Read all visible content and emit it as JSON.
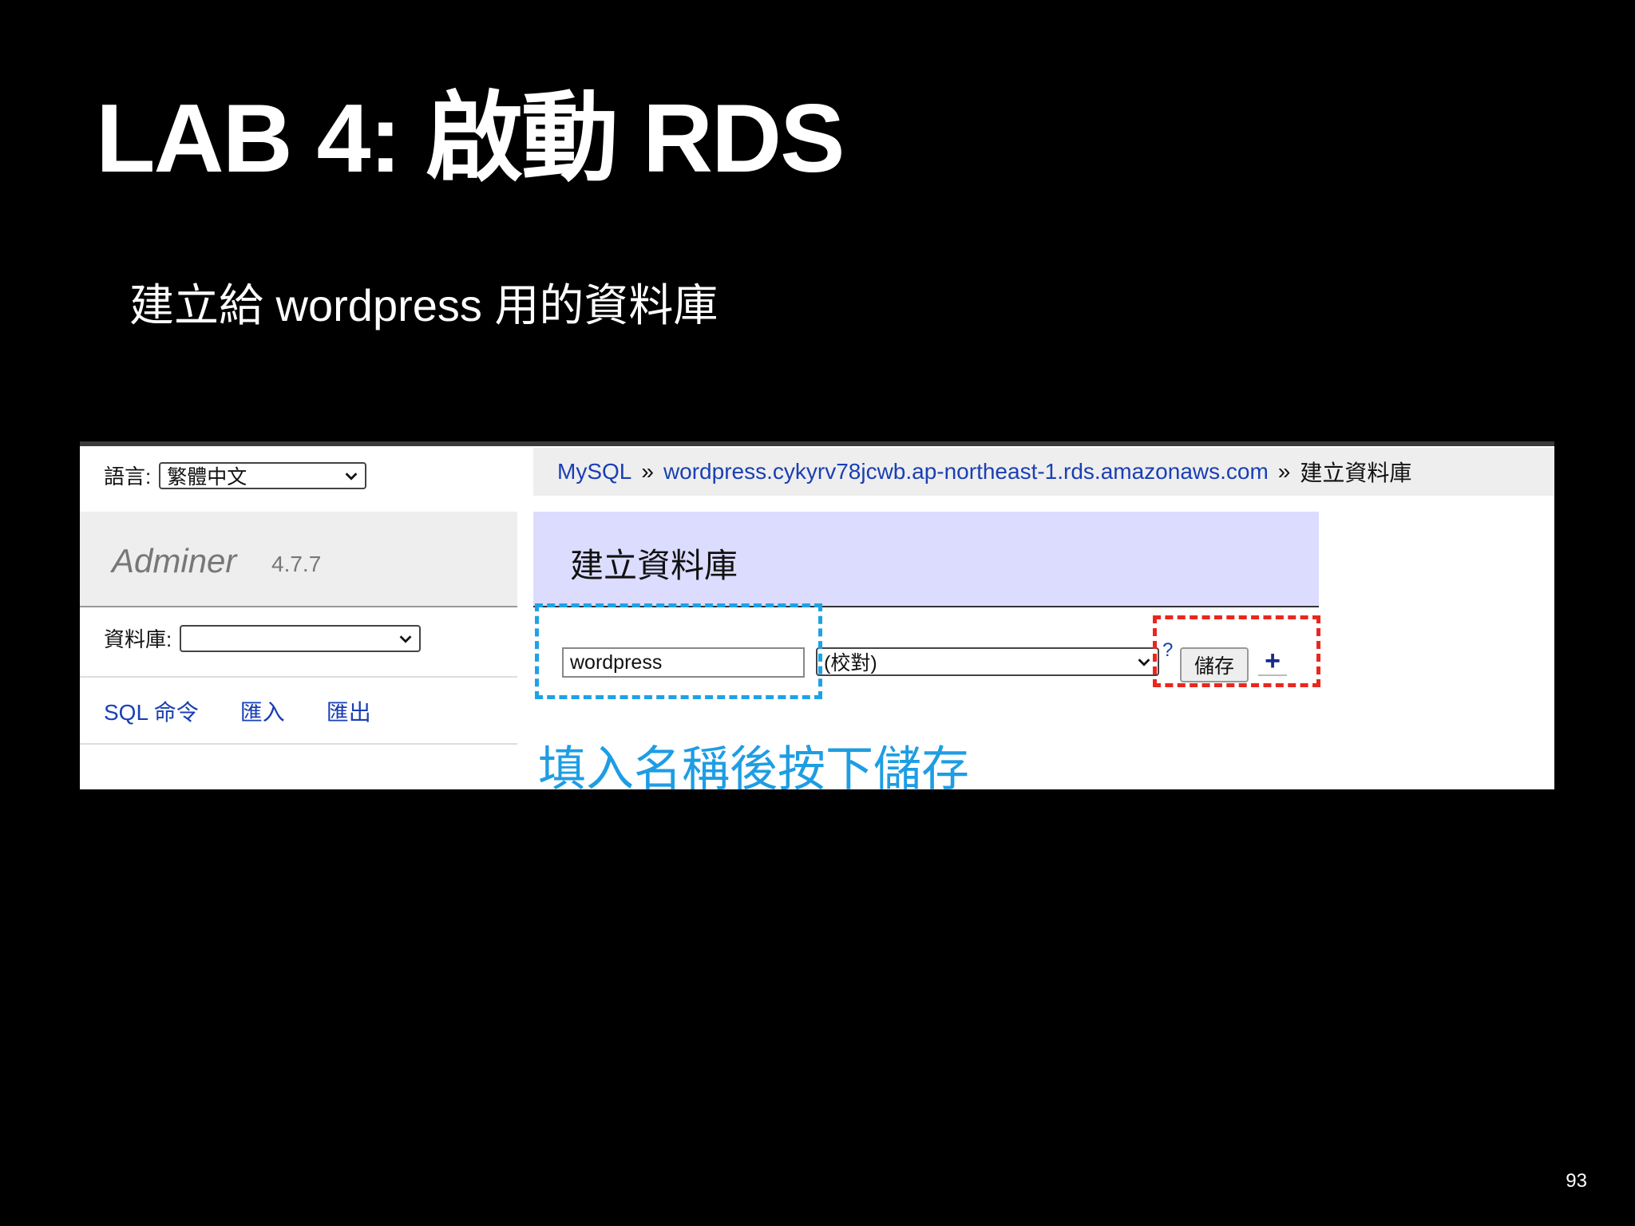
{
  "slide": {
    "title": "LAB 4: 啟動 RDS",
    "subtitle": "建立給 wordpress 用的資料庫",
    "page_number": "93"
  },
  "sidebar": {
    "language_label": "語言:",
    "language_value": "繁體中文",
    "brand_name": "Adminer",
    "brand_version": "4.7.7",
    "database_label": "資料庫:",
    "database_value": "",
    "links": [
      "SQL 命令",
      "匯入",
      "匯出"
    ]
  },
  "breadcrumb": {
    "root": "MySQL",
    "separator": "»",
    "host": "wordpress.cykyrv78jcwb.ap-northeast-1.rds.amazonaws.com",
    "current": "建立資料庫"
  },
  "form": {
    "heading": "建立資料庫",
    "name_value": "wordpress",
    "collation_value": "(校對)",
    "help_mark": "?",
    "save_label": "儲存",
    "add_label": "+"
  },
  "annotation": {
    "text": "填入名稱後按下儲存",
    "color": "#1e9de3"
  },
  "highlight_colors": {
    "input_box": "#1ea2e6",
    "save_box": "#e8281e"
  }
}
